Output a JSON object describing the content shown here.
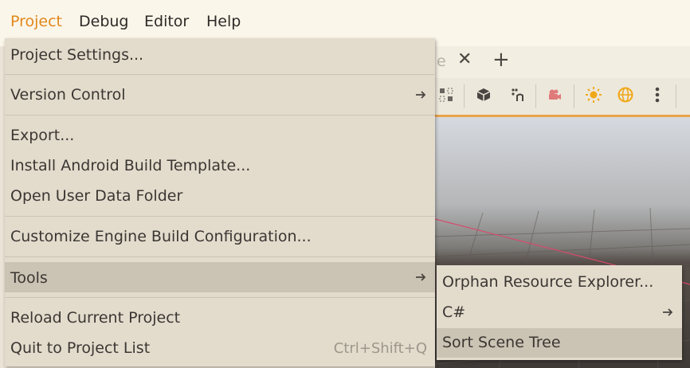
{
  "menubar": {
    "items": [
      "Project",
      "Debug",
      "Editor",
      "Help"
    ]
  },
  "background": {
    "tab_fragment": "e",
    "tab_close": "✕",
    "tab_add": "+"
  },
  "project_menu": {
    "items": [
      {
        "label": "Project Settings..."
      },
      {
        "label": "Version Control"
      },
      {
        "label": "Export..."
      },
      {
        "label": "Install Android Build Template..."
      },
      {
        "label": "Open User Data Folder"
      },
      {
        "label": "Customize Engine Build Configuration..."
      },
      {
        "label": "Tools"
      },
      {
        "label": "Reload Current Project"
      },
      {
        "label": "Quit to Project List",
        "shortcut": "Ctrl+Shift+Q"
      }
    ]
  },
  "tools_submenu": {
    "items": [
      {
        "label": "Orphan Resource Explorer..."
      },
      {
        "label": "C#"
      },
      {
        "label": "Sort Scene Tree"
      }
    ]
  },
  "colors": {
    "accent": "#e0881c",
    "menu_bg": "#e3dccd",
    "highlight": "#cbc3b4"
  }
}
